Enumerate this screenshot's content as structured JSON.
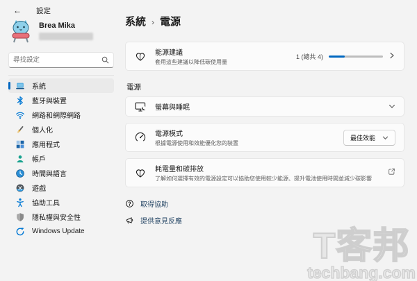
{
  "window": {
    "title": "設定",
    "back_icon": "←"
  },
  "user": {
    "name": "Brea Mika"
  },
  "search": {
    "placeholder": "尋找設定"
  },
  "sidebar": {
    "items": [
      {
        "label": "系統",
        "icon": "system-laptop",
        "selected": true
      },
      {
        "label": "藍牙與裝置",
        "icon": "bluetooth",
        "selected": false
      },
      {
        "label": "網路和網際網路",
        "icon": "wifi",
        "selected": false
      },
      {
        "label": "個人化",
        "icon": "paintbrush",
        "selected": false
      },
      {
        "label": "應用程式",
        "icon": "apps-grid",
        "selected": false
      },
      {
        "label": "帳戶",
        "icon": "person",
        "selected": false
      },
      {
        "label": "時間與語言",
        "icon": "clock-globe",
        "selected": false
      },
      {
        "label": "遊戲",
        "icon": "xbox",
        "selected": false
      },
      {
        "label": "協助工具",
        "icon": "accessibility-person",
        "selected": false
      },
      {
        "label": "隱私權與安全性",
        "icon": "shield",
        "selected": false
      },
      {
        "label": "Windows Update",
        "icon": "update-arrows",
        "selected": false
      }
    ]
  },
  "breadcrumb": {
    "parent": "系統",
    "separator": "›",
    "current": "電源"
  },
  "cards": {
    "energy_recommendations": {
      "title": "能源建議",
      "subtitle": "套用這些建議以降低碳使用量",
      "progress_label": "1 (總共 4)",
      "progress_percent": 30,
      "icon": "leaf-heart"
    },
    "power_section_label": "電源",
    "screen_sleep": {
      "title": "螢幕與睡眠",
      "icon": "monitor-moon"
    },
    "power_mode": {
      "title": "電源模式",
      "subtitle": "根據電源使用和效能優化您的裝置",
      "dropdown_value": "最佳效能",
      "icon": "gauge"
    },
    "energy_carbon": {
      "title": "耗電量和碳排放",
      "subtitle": "了解如何選擇有效的電源設定可以協助您使用較少能源、提升電池使用時間並減少碳影響",
      "icon": "leaf-heart"
    }
  },
  "footer_links": [
    {
      "label": "取得協助",
      "icon": "help-circle"
    },
    {
      "label": "提供意見反應",
      "icon": "feedback-megaphone"
    }
  ],
  "watermark": {
    "line1": "T客邦",
    "line2": "techbang.com"
  },
  "colors": {
    "accent": "#0067c0",
    "window_bg": "#f3f3f3",
    "card_bg": "#fbfbfb",
    "link_text": "#2a4a68"
  }
}
